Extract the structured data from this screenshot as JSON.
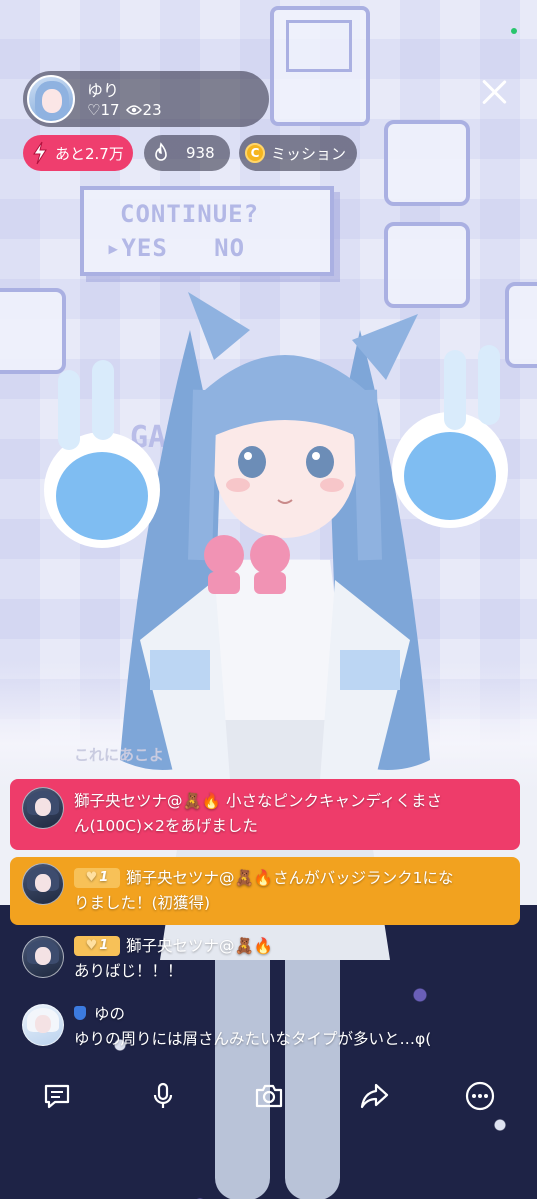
{
  "streamer": {
    "name": "ゆり",
    "hearts": "♡17",
    "views": "23"
  },
  "chips": {
    "ranking": "あと2.7万",
    "fire_count": "938",
    "mission": "ミッション",
    "coin_letter": "C"
  },
  "scene_text": {
    "continue": "CONTINUE?",
    "options": "▸YES   NO",
    "game": "GAME",
    "faded_chat": "これにあこよ"
  },
  "chat": [
    {
      "type": "gift",
      "user": "獅子央セツナ@🧸🔥",
      "message_line1": "小さなピンクキャンディくまさ",
      "message_line2": "ん(100C)×2をあげました"
    },
    {
      "type": "badge",
      "badge": "1",
      "user": "獅子央セツナ@🧸🔥",
      "message_line1": "さんがバッジランク1にな",
      "message_line2": "りました！(初獲得)"
    },
    {
      "type": "comment",
      "badge": "1",
      "user": "獅子央セツナ@🧸🔥",
      "message": "ありばじ！！！"
    },
    {
      "type": "comment",
      "user": "ゆの",
      "message": "ゆりの周りには屑さんみたいなタイプが多いと…φ("
    }
  ],
  "toolbar": {
    "icons": [
      "comment-icon",
      "microphone-icon",
      "camera-icon",
      "share-icon",
      "more-icon"
    ]
  },
  "colors": {
    "gift_bg": "#ee3c6a",
    "badge_bg": "#f2a21f",
    "ranking_chip": "#ef3e6e",
    "coin": "#f5b51f"
  }
}
